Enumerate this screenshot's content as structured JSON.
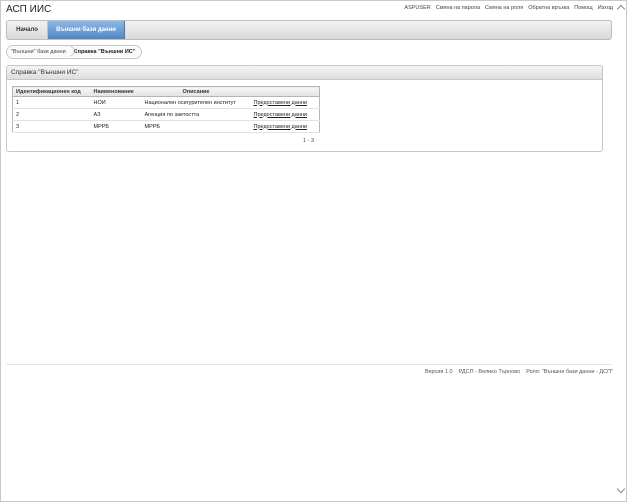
{
  "app": {
    "title": "АСП ИИС"
  },
  "toplinks": [
    "ASPUSER",
    "Смяна на парола",
    "Смяна на роля",
    "Обратна връзка",
    "Помощ",
    "Изход"
  ],
  "nav": {
    "home_label": "Начало",
    "active_label": "Външни бази данни"
  },
  "breadcrumb": {
    "parent": "\"Външни\" бази данни",
    "current": "Справка \"Външни ИС\""
  },
  "panel": {
    "title": "Справка \"Външни ИС\"",
    "columns": [
      "Идентификационен код",
      "Наименование",
      "Описание",
      ""
    ],
    "rows": [
      {
        "id": "1",
        "name": "НОИ",
        "description": "Национален осигурителен институт",
        "link": "Предоставени данни"
      },
      {
        "id": "2",
        "name": "АЗ",
        "description": "Агенция по заетостта",
        "link": "Предоставени данни"
      },
      {
        "id": "3",
        "name": "МРРБ",
        "description": "МРРБ",
        "link": "Предоставени данни"
      }
    ],
    "pager": "1 - 3"
  },
  "footer": {
    "version": "Версия 1.0",
    "office": "РДСП - Велико Търново",
    "role": "Роля: \"Външни бази данни - ДСП\""
  }
}
